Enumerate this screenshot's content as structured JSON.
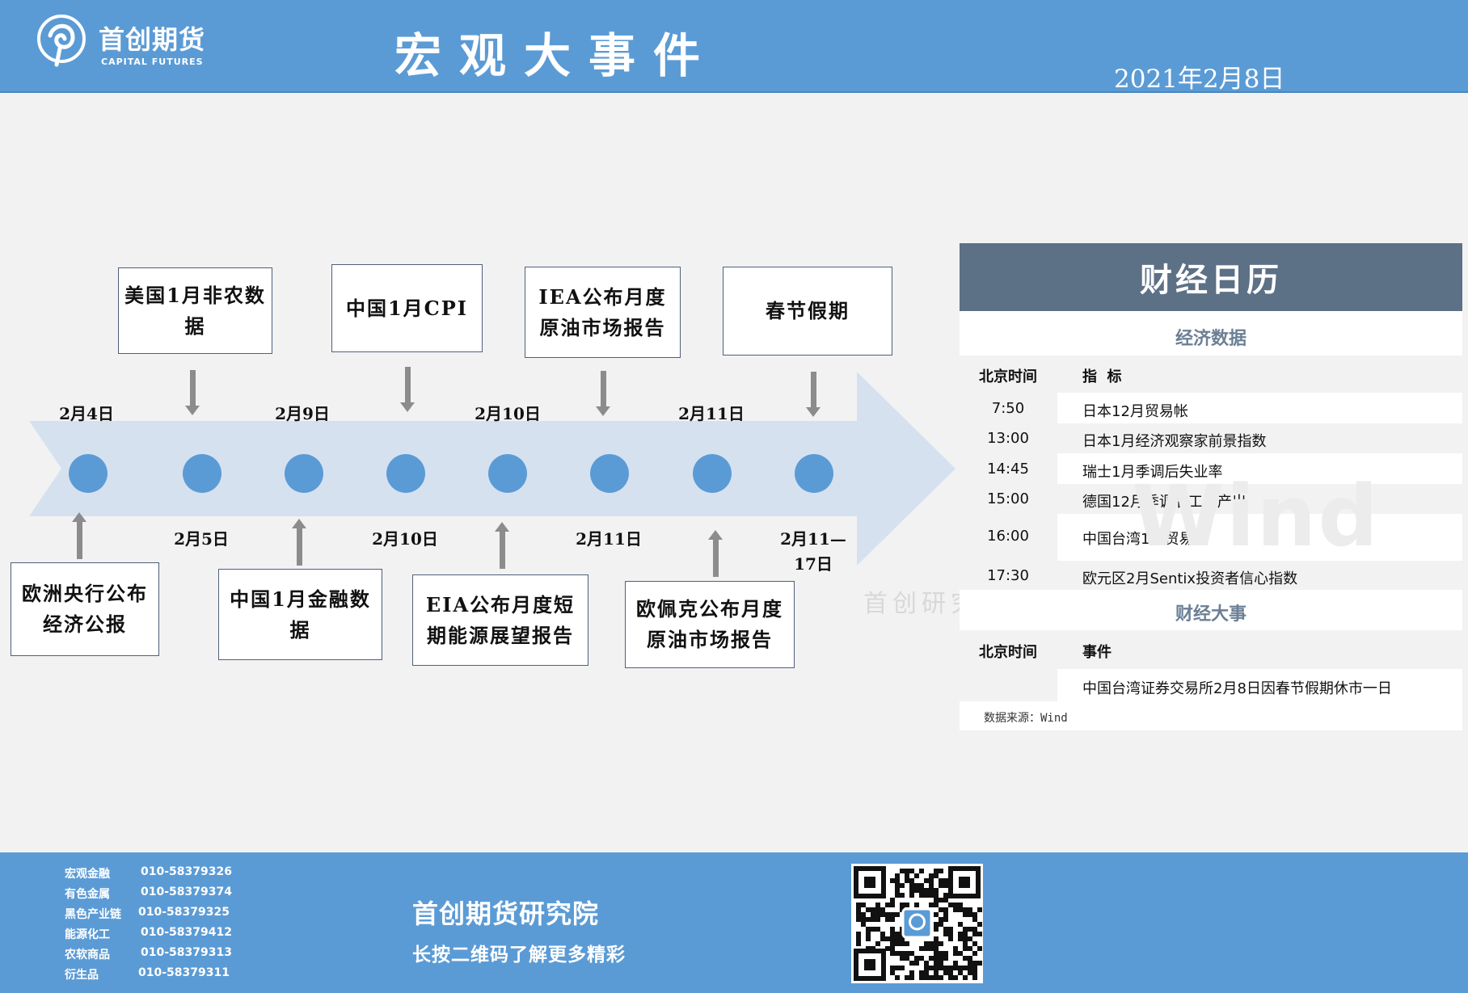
{
  "header": {
    "logo_cn": "首创期货",
    "logo_en": "CAPITAL FUTURES",
    "title": "宏观大事件",
    "date": "2021年2月8日"
  },
  "timeline": {
    "top_dates": [
      "2月4日",
      "2月9日",
      "2月10日",
      "2月11日"
    ],
    "bottom_dates": [
      "2月5日",
      "2月10日",
      "2月11日",
      "2月11—",
      "17日"
    ],
    "top_events": [
      "美国1月非农数据",
      "中国1月CPI",
      "IEA公布月度原油市场报告",
      "春节假期"
    ],
    "bottom_events": [
      "欧洲央行公布经济公报",
      "中国1月金融数据",
      "EIA公布月度短期能源展望报告",
      "欧佩克公布月度原油市场报告"
    ]
  },
  "calendar": {
    "title": "财经日历",
    "economic_section": "经济数据",
    "col_time": "北京时间",
    "col_indicator": "指  标",
    "economic_rows": [
      {
        "time": "7:50",
        "item": "日本12月贸易帐"
      },
      {
        "time": "13:00",
        "item": "日本1月经济观察家前景指数"
      },
      {
        "time": "14:45",
        "item": "瑞士1月季调后失业率"
      },
      {
        "time": "15:00",
        "item": "德国12月季调后工业产出"
      },
      {
        "time": "16:00",
        "item": "中国台湾1月贸易帐"
      },
      {
        "time": "17:30",
        "item": "欧元区2月Sentix投资者信心指数"
      }
    ],
    "events_section": "财经大事",
    "col_event": "事件",
    "event_rows": [
      {
        "time": "",
        "item": "中国台湾证券交易所2月8日因春节假期休市一日"
      }
    ],
    "source": "数据来源：Wind",
    "watermark": "Wind",
    "watermark_cn": "首创研究"
  },
  "footer": {
    "contacts": [
      {
        "dept": "宏观金融",
        "phone": "010-58379326"
      },
      {
        "dept": "有色金属",
        "phone": "010-58379374"
      },
      {
        "dept": "黑色产业链",
        "phone": "010-58379325"
      },
      {
        "dept": "能源化工",
        "phone": "010-58379412"
      },
      {
        "dept": "农软商品",
        "phone": "010-58379313"
      },
      {
        "dept": "衍生品",
        "phone": "010-58379311"
      }
    ],
    "org": "首创期货研究院",
    "slogan": "长按二维码了解更多精彩"
  },
  "colors": {
    "brand_blue": "#5b9bd5",
    "panel_header": "#5c7086",
    "arrow_fill": "#d6e1f0"
  }
}
